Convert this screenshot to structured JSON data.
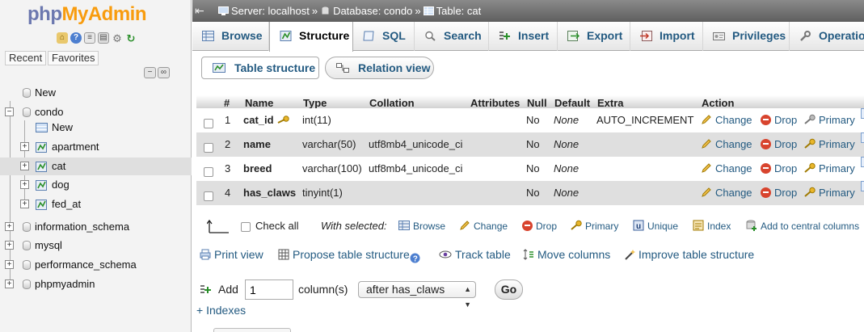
{
  "nav": {
    "logo_php": "php",
    "logo_myadmin": "MyAdmin",
    "tab_recent": "Recent",
    "tab_favorites": "Favorites",
    "tree": [
      {
        "label": "New"
      },
      {
        "label": "condo"
      },
      {
        "label": "New"
      },
      {
        "label": "apartment"
      },
      {
        "label": "cat"
      },
      {
        "label": "dog"
      },
      {
        "label": "fed_at"
      },
      {
        "label": "information_schema"
      },
      {
        "label": "mysql"
      },
      {
        "label": "performance_schema"
      },
      {
        "label": "phpmyadmin"
      }
    ]
  },
  "breadcrumb": {
    "server": "Server: localhost",
    "database": "Database: condo",
    "table": "Table: cat",
    "separator": "»"
  },
  "tabs": [
    "Browse",
    "Structure",
    "SQL",
    "Search",
    "Insert",
    "Export",
    "Import",
    "Privileges",
    "Operations"
  ],
  "subtabs": [
    "Table structure",
    "Relation view"
  ],
  "table": {
    "headers": {
      "num": "#",
      "name": "Name",
      "type": "Type",
      "collation": "Collation",
      "attributes": "Attributes",
      "null": "Null",
      "default": "Default",
      "extra": "Extra",
      "action": "Action"
    },
    "rows": [
      {
        "num": "1",
        "name": "cat_id",
        "type": "int(11)",
        "collation": "",
        "null": "No",
        "default": "None",
        "extra": "AUTO_INCREMENT"
      },
      {
        "num": "2",
        "name": "name",
        "type": "varchar(50)",
        "collation": "utf8mb4_unicode_ci",
        "null": "No",
        "default": "None",
        "extra": ""
      },
      {
        "num": "3",
        "name": "breed",
        "type": "varchar(100)",
        "collation": "utf8mb4_unicode_ci",
        "null": "No",
        "default": "None",
        "extra": ""
      },
      {
        "num": "4",
        "name": "has_claws",
        "type": "tinyint(1)",
        "collation": "",
        "null": "No",
        "default": "None",
        "extra": ""
      }
    ],
    "actions": {
      "change": "Change",
      "drop": "Drop",
      "primary": "Primary"
    }
  },
  "bulk": {
    "check_all": "Check all",
    "with_selected": "With selected:",
    "browse": "Browse",
    "change": "Change",
    "drop": "Drop",
    "primary": "Primary",
    "unique": "Unique",
    "index": "Index",
    "central": "Add to central columns"
  },
  "links": {
    "print_view": "Print view",
    "propose": "Propose table structure",
    "track": "Track table",
    "move": "Move columns",
    "improve": "Improve table structure"
  },
  "add_columns": {
    "add_label": "Add",
    "count": "1",
    "columns_label": "column(s)",
    "position": "after has_claws",
    "go": "Go"
  },
  "indexes_link": "+ Indexes",
  "colors": {
    "link": "#235a81",
    "logo_php": "#6c78af",
    "logo_myadmin": "#f89c0e",
    "drop": "#d8442e",
    "topbar": "#6e6e6e"
  }
}
